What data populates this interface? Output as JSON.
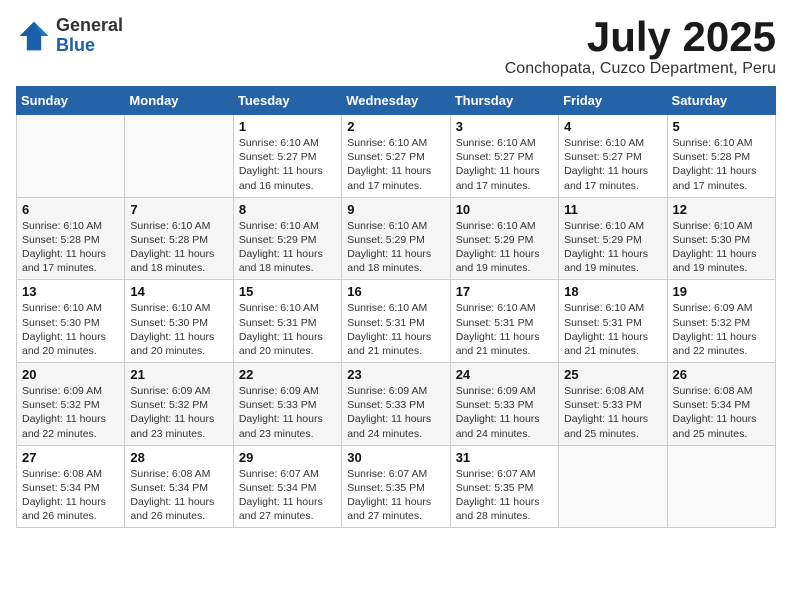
{
  "logo": {
    "general": "General",
    "blue": "Blue"
  },
  "title": "July 2025",
  "location": "Conchopata, Cuzco Department, Peru",
  "days_of_week": [
    "Sunday",
    "Monday",
    "Tuesday",
    "Wednesday",
    "Thursday",
    "Friday",
    "Saturday"
  ],
  "weeks": [
    [
      {
        "day": "",
        "info": ""
      },
      {
        "day": "",
        "info": ""
      },
      {
        "day": "1",
        "info": "Sunrise: 6:10 AM\nSunset: 5:27 PM\nDaylight: 11 hours and 16 minutes."
      },
      {
        "day": "2",
        "info": "Sunrise: 6:10 AM\nSunset: 5:27 PM\nDaylight: 11 hours and 17 minutes."
      },
      {
        "day": "3",
        "info": "Sunrise: 6:10 AM\nSunset: 5:27 PM\nDaylight: 11 hours and 17 minutes."
      },
      {
        "day": "4",
        "info": "Sunrise: 6:10 AM\nSunset: 5:27 PM\nDaylight: 11 hours and 17 minutes."
      },
      {
        "day": "5",
        "info": "Sunrise: 6:10 AM\nSunset: 5:28 PM\nDaylight: 11 hours and 17 minutes."
      }
    ],
    [
      {
        "day": "6",
        "info": "Sunrise: 6:10 AM\nSunset: 5:28 PM\nDaylight: 11 hours and 17 minutes."
      },
      {
        "day": "7",
        "info": "Sunrise: 6:10 AM\nSunset: 5:28 PM\nDaylight: 11 hours and 18 minutes."
      },
      {
        "day": "8",
        "info": "Sunrise: 6:10 AM\nSunset: 5:29 PM\nDaylight: 11 hours and 18 minutes."
      },
      {
        "day": "9",
        "info": "Sunrise: 6:10 AM\nSunset: 5:29 PM\nDaylight: 11 hours and 18 minutes."
      },
      {
        "day": "10",
        "info": "Sunrise: 6:10 AM\nSunset: 5:29 PM\nDaylight: 11 hours and 19 minutes."
      },
      {
        "day": "11",
        "info": "Sunrise: 6:10 AM\nSunset: 5:29 PM\nDaylight: 11 hours and 19 minutes."
      },
      {
        "day": "12",
        "info": "Sunrise: 6:10 AM\nSunset: 5:30 PM\nDaylight: 11 hours and 19 minutes."
      }
    ],
    [
      {
        "day": "13",
        "info": "Sunrise: 6:10 AM\nSunset: 5:30 PM\nDaylight: 11 hours and 20 minutes."
      },
      {
        "day": "14",
        "info": "Sunrise: 6:10 AM\nSunset: 5:30 PM\nDaylight: 11 hours and 20 minutes."
      },
      {
        "day": "15",
        "info": "Sunrise: 6:10 AM\nSunset: 5:31 PM\nDaylight: 11 hours and 20 minutes."
      },
      {
        "day": "16",
        "info": "Sunrise: 6:10 AM\nSunset: 5:31 PM\nDaylight: 11 hours and 21 minutes."
      },
      {
        "day": "17",
        "info": "Sunrise: 6:10 AM\nSunset: 5:31 PM\nDaylight: 11 hours and 21 minutes."
      },
      {
        "day": "18",
        "info": "Sunrise: 6:10 AM\nSunset: 5:31 PM\nDaylight: 11 hours and 21 minutes."
      },
      {
        "day": "19",
        "info": "Sunrise: 6:09 AM\nSunset: 5:32 PM\nDaylight: 11 hours and 22 minutes."
      }
    ],
    [
      {
        "day": "20",
        "info": "Sunrise: 6:09 AM\nSunset: 5:32 PM\nDaylight: 11 hours and 22 minutes."
      },
      {
        "day": "21",
        "info": "Sunrise: 6:09 AM\nSunset: 5:32 PM\nDaylight: 11 hours and 23 minutes."
      },
      {
        "day": "22",
        "info": "Sunrise: 6:09 AM\nSunset: 5:33 PM\nDaylight: 11 hours and 23 minutes."
      },
      {
        "day": "23",
        "info": "Sunrise: 6:09 AM\nSunset: 5:33 PM\nDaylight: 11 hours and 24 minutes."
      },
      {
        "day": "24",
        "info": "Sunrise: 6:09 AM\nSunset: 5:33 PM\nDaylight: 11 hours and 24 minutes."
      },
      {
        "day": "25",
        "info": "Sunrise: 6:08 AM\nSunset: 5:33 PM\nDaylight: 11 hours and 25 minutes."
      },
      {
        "day": "26",
        "info": "Sunrise: 6:08 AM\nSunset: 5:34 PM\nDaylight: 11 hours and 25 minutes."
      }
    ],
    [
      {
        "day": "27",
        "info": "Sunrise: 6:08 AM\nSunset: 5:34 PM\nDaylight: 11 hours and 26 minutes."
      },
      {
        "day": "28",
        "info": "Sunrise: 6:08 AM\nSunset: 5:34 PM\nDaylight: 11 hours and 26 minutes."
      },
      {
        "day": "29",
        "info": "Sunrise: 6:07 AM\nSunset: 5:34 PM\nDaylight: 11 hours and 27 minutes."
      },
      {
        "day": "30",
        "info": "Sunrise: 6:07 AM\nSunset: 5:35 PM\nDaylight: 11 hours and 27 minutes."
      },
      {
        "day": "31",
        "info": "Sunrise: 6:07 AM\nSunset: 5:35 PM\nDaylight: 11 hours and 28 minutes."
      },
      {
        "day": "",
        "info": ""
      },
      {
        "day": "",
        "info": ""
      }
    ]
  ]
}
